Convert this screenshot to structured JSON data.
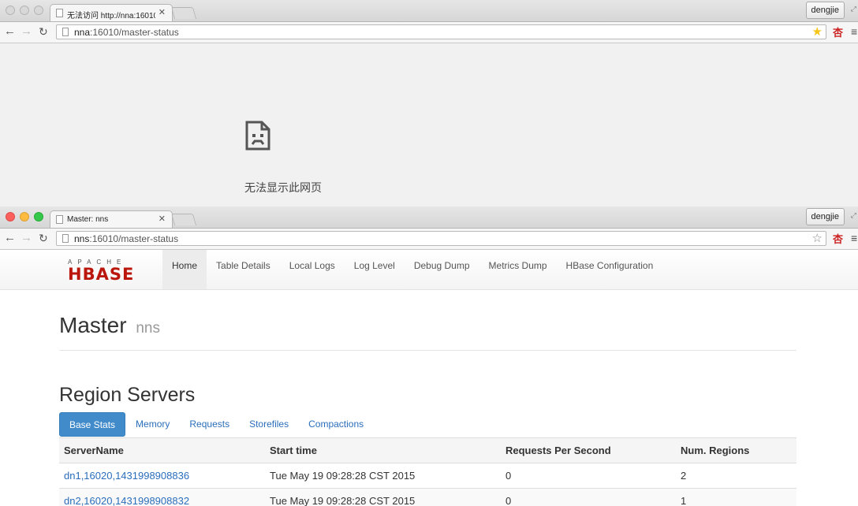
{
  "window1": {
    "tab_title": "无法访问 http://nna:16010",
    "profile_name": "dengjie",
    "url_host": "nna",
    "url_rest": ":16010/master-status",
    "error_message": "无法显示此网页",
    "icons": {
      "star": "star-filled-icon",
      "extension": "extension-icon"
    }
  },
  "window2": {
    "tab_title": "Master: nns",
    "profile_name": "dengjie",
    "url_host": "nns",
    "url_rest": ":16010/master-status",
    "logo": {
      "top": "APACHE",
      "main": "HBASE"
    },
    "nav": [
      "Home",
      "Table Details",
      "Local Logs",
      "Log Level",
      "Debug Dump",
      "Metrics Dump",
      "HBase Configuration"
    ],
    "master_title": "Master",
    "master_name": "nns",
    "section_title": "Region Servers",
    "tabs": [
      "Base Stats",
      "Memory",
      "Requests",
      "Storefiles",
      "Compactions"
    ],
    "table": {
      "headers": [
        "ServerName",
        "Start time",
        "Requests Per Second",
        "Num. Regions"
      ],
      "rows": [
        [
          "dn1,16020,1431998908836",
          "Tue May 19 09:28:28 CST 2015",
          "0",
          "2"
        ],
        [
          "dn2,16020,1431998908832",
          "Tue May 19 09:28:28 CST 2015",
          "0",
          "1"
        ]
      ]
    }
  },
  "colors": {
    "hbase_red": "#ba160c",
    "link_blue": "#2a6ebb",
    "active_tab": "#428bca"
  }
}
